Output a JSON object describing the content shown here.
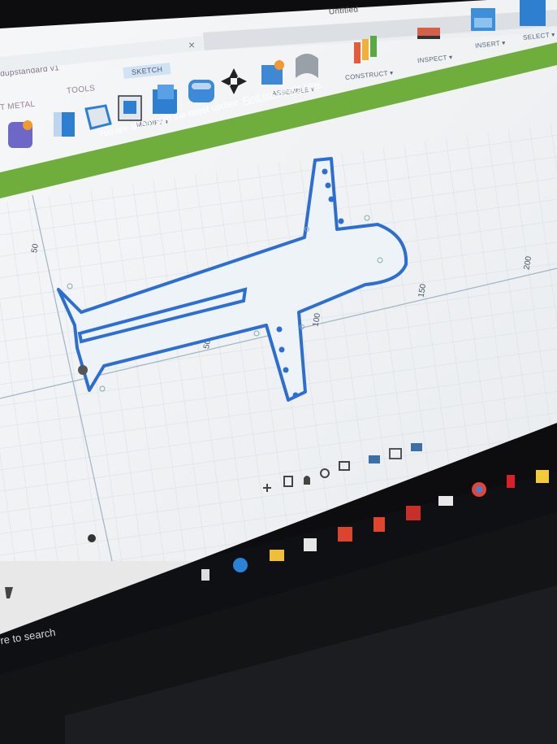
{
  "window": {
    "file_title": "dupstandard v1",
    "top_title": "Untitled"
  },
  "toolbar": {
    "sheet_metal_label": "T METAL",
    "tools_label": "TOOLS",
    "sketch_tab": "SKETCH",
    "modify_label": "MODIFY ▾",
    "assemble_label": "ASSEMBLE ▾",
    "construct_label": "CONSTRUCT ▾",
    "inspect_label": "INSPECT ▾",
    "insert_label": "INSERT ▾",
    "select_label": "SELECT ▾"
  },
  "banner": {
    "message": "You are all set with the latest update.",
    "link": "Find out what's new."
  },
  "canvas": {
    "axis_labels": [
      "50",
      "50",
      "100",
      "150",
      "200"
    ]
  },
  "taskbar": {
    "search_placeholder": "re to search"
  },
  "colors": {
    "banner_green": "#6fae3c",
    "sketch_blue": "#2c6fd1",
    "canvas_bg": "#f2f4f6",
    "grid_line": "#d6dbe2"
  }
}
